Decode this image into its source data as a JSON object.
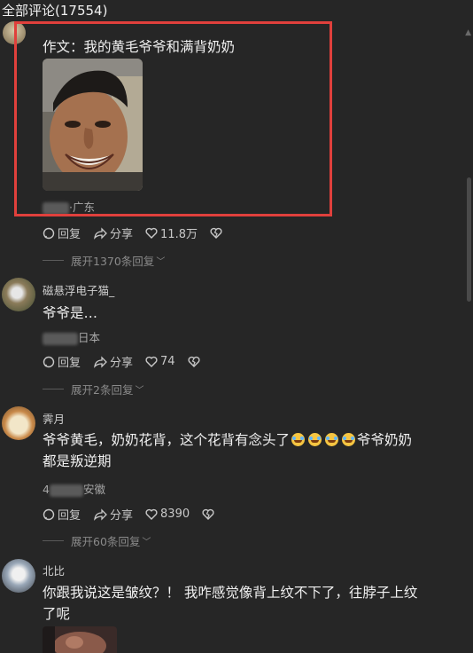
{
  "header": {
    "title": "全部评论(17554)"
  },
  "comments": [
    {
      "text": "作文：我的黄毛爷爷和满背奶奶",
      "location": "·广东",
      "reply_label": "回复",
      "share_label": "分享",
      "likes": "11.8万",
      "expand": "展开1370条回复"
    },
    {
      "username": "磁悬浮电子猫_",
      "text": "爷爷是…",
      "location": "日本",
      "reply_label": "回复",
      "share_label": "分享",
      "likes": "74",
      "expand": "展开2条回复"
    },
    {
      "username": "霁月",
      "text_line1": "爷爷黄毛，奶奶花背，这个花背有念头了",
      "text_line1_tail": "爷爷奶奶",
      "text_line2": "都是叛逆期",
      "time_prefix": "4",
      "location": "安徽",
      "reply_label": "回复",
      "share_label": "分享",
      "likes": "8390",
      "expand": "展开60条回复"
    },
    {
      "username": "北比",
      "text_line1": "你跟我说这是皱纹？！ 我咋感觉像背上纹不下了，往脖子上纹",
      "text_line2": "了呢"
    }
  ],
  "colors": {
    "highlight_box": "#e0403c",
    "background": "#262626"
  }
}
